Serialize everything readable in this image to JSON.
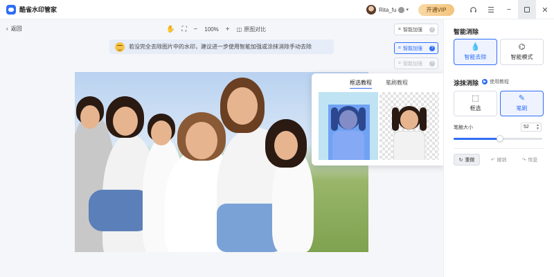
{
  "app": {
    "title": "酷雀水印管家",
    "username": "Rita_fu",
    "vip_button": "开通VIP"
  },
  "toolbar": {
    "back": "返回",
    "zoom": "100%",
    "compare": "原图对比"
  },
  "side_buttons": {
    "enhance_1": "智能加强",
    "enhance_2": "智能加强",
    "enhance_3": "智能加强"
  },
  "hint": "若没完全去除图片中的水印，建议进一步使用智能加强或涂抹消除手动去除",
  "popover": {
    "tab_box": "框选教程",
    "tab_brush": "笔刷教程"
  },
  "panel": {
    "smart_title": "智能消除",
    "smart_remove": "智能去除",
    "smart_mode": "智能模式",
    "smear_title": "涂抹消除",
    "tutorial": "使用教程",
    "box_select": "框选",
    "brush": "笔刷",
    "brush_size_label": "笔触大小",
    "brush_size": "52",
    "brush_size_fraction": 0.52,
    "reset": "重做",
    "undo": "撤销",
    "redo": "恢复"
  },
  "colors": {
    "accent": "#2f6df6",
    "vip": "#f3c47d"
  }
}
